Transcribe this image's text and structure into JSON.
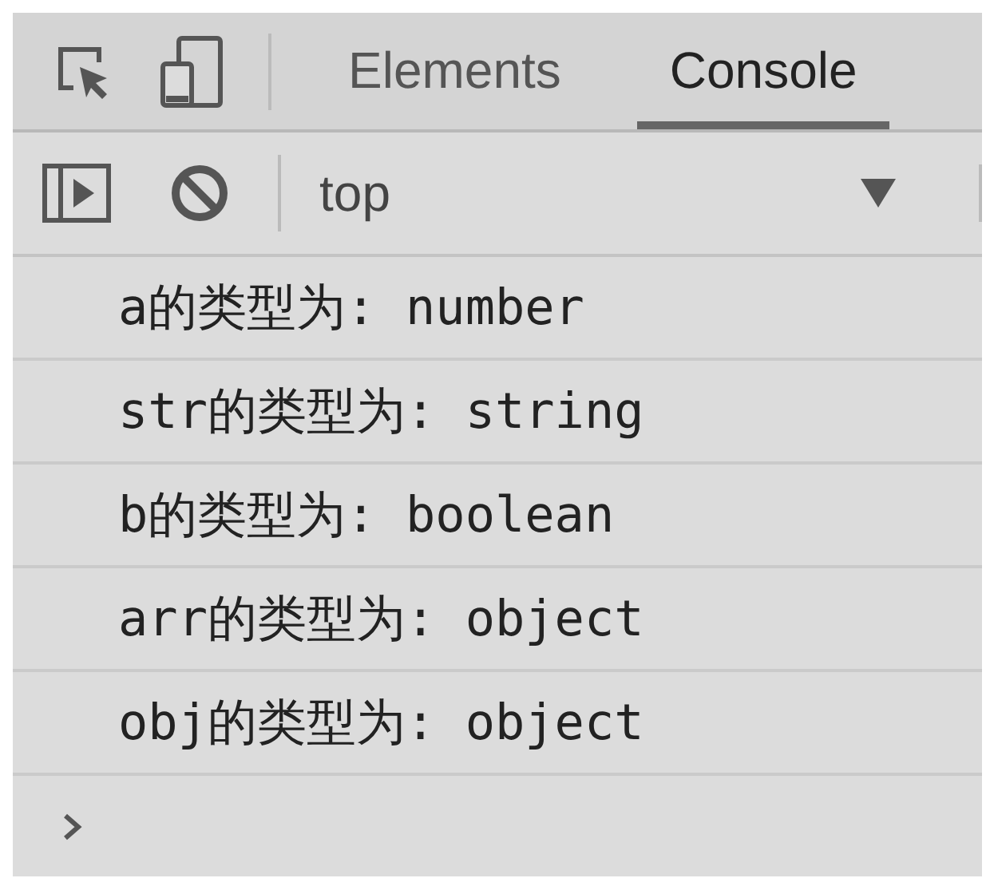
{
  "tabs": [
    {
      "label": "Elements",
      "selected": false
    },
    {
      "label": "Console",
      "selected": true
    }
  ],
  "context_selector": {
    "value": "top"
  },
  "messages": [
    "a的类型为: number",
    "str的类型为: string",
    "b的类型为: boolean",
    "arr的类型为: object",
    "obj的类型为: object"
  ]
}
